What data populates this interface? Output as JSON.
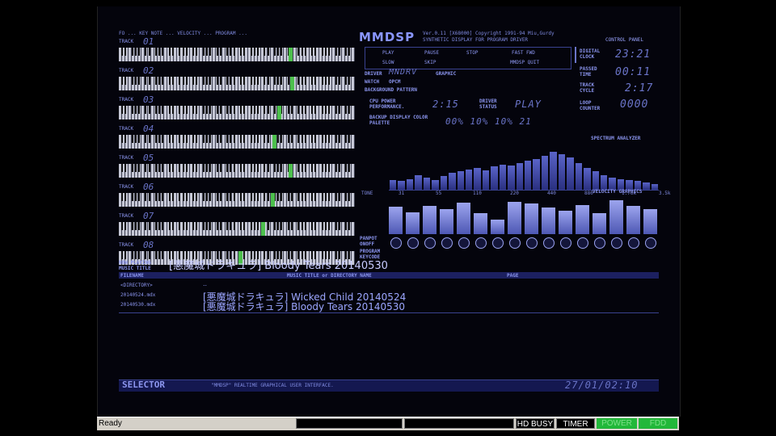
{
  "status_bar": {
    "ready": "Ready",
    "hd_busy": "HD BUSY",
    "timer": "TIMER",
    "power_label": "POWER",
    "fdd_label": "FDD"
  },
  "app": {
    "logo": "MMDSP",
    "subtitle_line1": "Ver.0.11 [X68000] Copyright 1991-94 Miu,Gurdy",
    "subtitle_line2": "SYNTHETIC DISPLAY FOR PROGRAM DRIVER",
    "control_panel": "CONTROL PANEL",
    "header_row": "FO  ...  KEY NOTE  ...  VELOCITY  ...  PROGRAM  ..."
  },
  "tracks": [
    {
      "label": "TRACK",
      "num": "01"
    },
    {
      "label": "TRACK",
      "num": "02"
    },
    {
      "label": "TRACK",
      "num": "03"
    },
    {
      "label": "TRACK",
      "num": "04"
    },
    {
      "label": "TRACK",
      "num": "05"
    },
    {
      "label": "TRACK",
      "num": "06"
    },
    {
      "label": "TRACK",
      "num": "07"
    },
    {
      "label": "TRACK",
      "num": "08"
    }
  ],
  "buttons": {
    "play": "PLAY",
    "pause": "PAUSE",
    "stop": "STOP",
    "fast_fwd": "FAST FWD",
    "slow": "SLOW",
    "skip": "SKIP",
    "mmdsp_quit": "MMDSP QUIT"
  },
  "driver": {
    "driver_label": "DRIVER",
    "driver_value": "MNDRV",
    "graphic_label": "GRAPHIC",
    "watch_label": "WATCH",
    "watch_value": "OPCM",
    "pattern_label": "BACKGROUND PATTERN"
  },
  "clock": {
    "digital_clock_label": "DIGITAL CLOCK",
    "digital_clock_value": "23:21",
    "passed_time_label": "PASSED TIME",
    "passed_time_value": "00:11",
    "track_cycle_label": "TRACK CYCLE",
    "track_cycle_value": "2:17",
    "loop_counter_label": "LOOP COUNTER",
    "loop_counter_value": "0000"
  },
  "perf": {
    "cpu_power_label": "CPU POWER PERFORMANCE.",
    "cpu_power_value": "2:15",
    "driver_status_label": "DRIVER STATUS",
    "driver_status_value": "PLAY",
    "palette_label": "BACKUP DISPLAY COLOR PALETTE",
    "palette_values": "00% 10% 10% 21"
  },
  "spectrum": {
    "label": "SPECTRUM ANALYZER",
    "freqs": [
      "TONE",
      "31",
      "55",
      "110",
      "220",
      "440",
      "880",
      "1.76k",
      "3.5k"
    ],
    "levels": [
      0.2,
      0.18,
      0.22,
      0.3,
      0.25,
      0.2,
      0.28,
      0.35,
      0.38,
      0.42,
      0.45,
      0.4,
      0.48,
      0.52,
      0.5,
      0.55,
      0.6,
      0.64,
      0.7,
      0.78,
      0.74,
      0.66,
      0.55,
      0.45,
      0.38,
      0.3,
      0.25,
      0.22,
      0.2,
      0.18,
      0.15,
      0.12
    ]
  },
  "velocity": {
    "label": "VELOCITY GRAPHICS",
    "levels": [
      0.78,
      0.62,
      0.8,
      0.7,
      0.88,
      0.6,
      0.42,
      0.92,
      0.86,
      0.74,
      0.66,
      0.82,
      0.58,
      0.95,
      0.8,
      0.7
    ],
    "knob_row1": "PANPOT ONOFF",
    "knob_row2": "PROGRAM KEYCODE"
  },
  "now_playing": {
    "label": "NOW PLAYING MUSIC TITLE",
    "title": "[悪魔城ドラキュラ] Bloody Tears  20140530"
  },
  "filelist": {
    "col_filename": "FILENAME",
    "col_title": "MUSIC TITLE or DIRECTORY NAME",
    "col_page": "PAGE",
    "rows": [
      {
        "name": "<DIRECTORY>",
        "title": ".."
      },
      {
        "name": "20140524.mdx",
        "title": "[悪魔城ドラキュラ] Wicked Child  20140524"
      },
      {
        "name": "20140530.mdx",
        "title": "[悪魔城ドラキュラ] Bloody Tears  20140530"
      }
    ]
  },
  "selector": {
    "label": "SELECTOR",
    "tagline": "\"MMDSP\" REALTIME GRAPHICAL USER INTERFACE.",
    "datetime": "27/01/02:10"
  }
}
